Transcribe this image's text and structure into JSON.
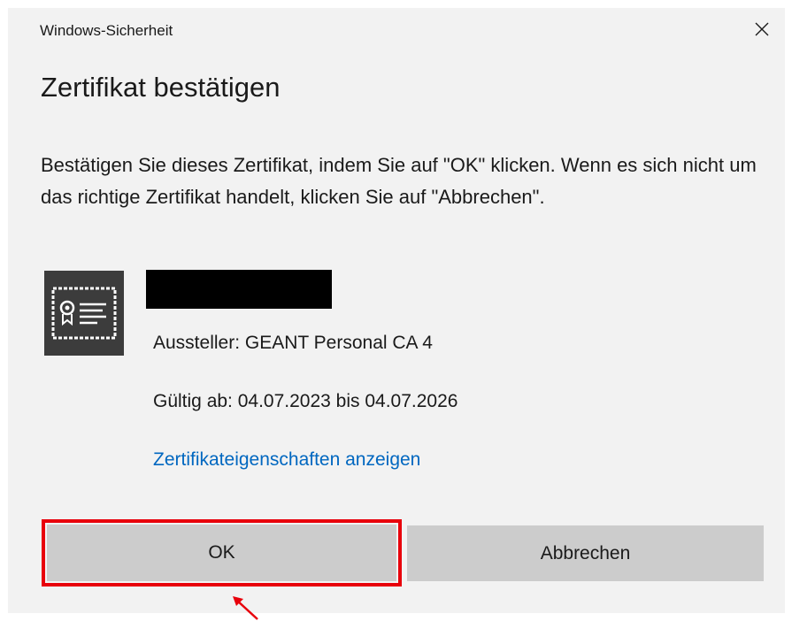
{
  "window": {
    "title": "Windows-Sicherheit",
    "close_icon": "close-icon"
  },
  "dialog": {
    "heading": "Zertifikat bestätigen",
    "message": "Bestätigen Sie dieses Zertifikat, indem Sie auf \"OK\" klicken. Wenn es sich nicht um das richtige Zertifikat handelt, klicken Sie auf \"Abbrechen\"."
  },
  "certificate": {
    "icon": "certificate-icon",
    "issuer": "Aussteller: GEANT Personal CA 4",
    "validity": "Gültig ab: 04.07.2023 bis 04.07.2026",
    "properties_link": "Zertifikateigenschaften anzeigen"
  },
  "buttons": {
    "ok_label": "OK",
    "cancel_label": "Abbrechen"
  },
  "annotation": {
    "highlight_color": "#e8000b",
    "arrow_icon": "arrow-icon"
  },
  "colors": {
    "dialog_background": "#f2f2f2",
    "button_background": "#cccccc",
    "link": "#0067c0",
    "icon_background": "#3c3c3c"
  }
}
